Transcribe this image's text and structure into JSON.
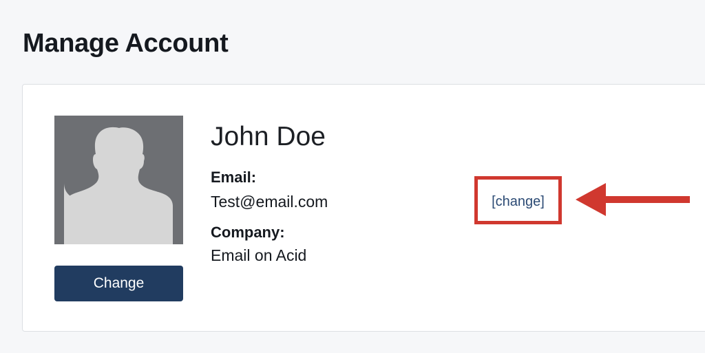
{
  "page": {
    "title": "Manage Account"
  },
  "profile": {
    "name": "John Doe",
    "change_photo_label": "Change",
    "email_label": "Email:",
    "email_value": "Test@email.com",
    "company_label": "Company:",
    "company_value": "Email on Acid",
    "change_email_link": "[change]"
  },
  "icons": {
    "avatar": "user-silhouette-icon",
    "annotation": "arrow-left-icon"
  },
  "colors": {
    "page_background": "#f6f7f9",
    "button_background": "#213c60",
    "link": "#2b4a74",
    "annotation": "#d0382f",
    "avatar_background": "#6d6f73",
    "avatar_silhouette": "#d6d6d6"
  }
}
